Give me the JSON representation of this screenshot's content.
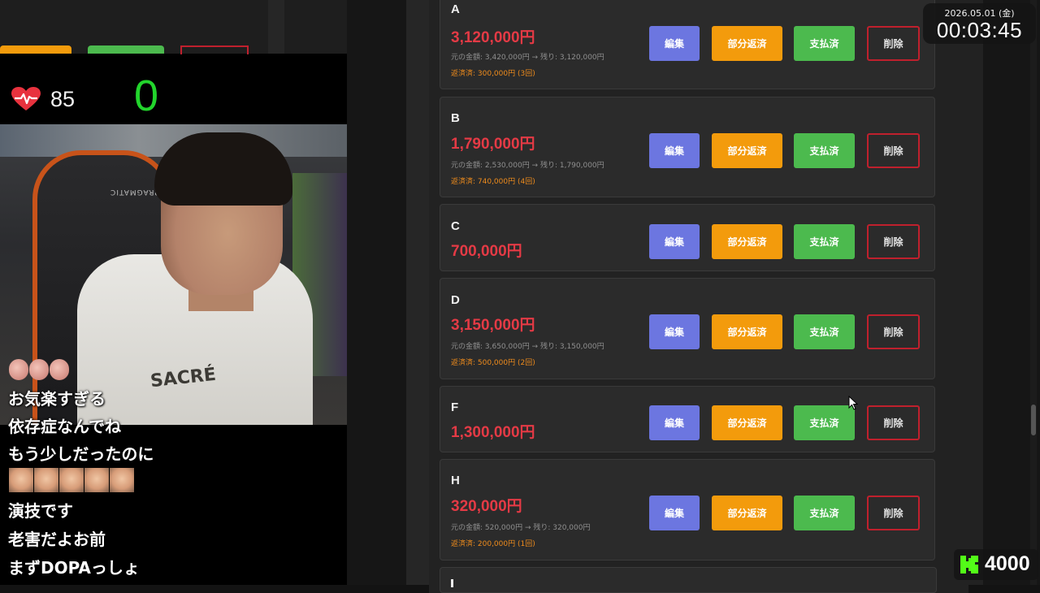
{
  "overlay": {
    "heart_rate": "85",
    "counter": "0",
    "chair_label": "PRAGMATIC",
    "shirt_print": "SACRÉ",
    "chat": [
      "お気楽すぎる",
      "依存症なんでね",
      "もう少しだったのに",
      "演技です",
      "老害だよお前",
      "まずDOPAっしょ"
    ]
  },
  "clock": {
    "date": "2026.05.01 (金)",
    "time": "00:03:45"
  },
  "kick_viewers": "4000",
  "buttons": {
    "edit": "編集",
    "partial": "部分返済",
    "paid": "支払済",
    "delete": "削除"
  },
  "debts": [
    {
      "name": "A",
      "amount": "3,120,000円",
      "detail": "元の金額: 3,420,000円 → 残り: 3,120,000円",
      "repaid": "返済済: 300,000円 (3回)"
    },
    {
      "name": "B",
      "amount": "1,790,000円",
      "detail": "元の金額: 2,530,000円 → 残り: 1,790,000円",
      "repaid": "返済済: 740,000円 (4回)"
    },
    {
      "name": "C",
      "amount": "700,000円",
      "detail": "",
      "repaid": ""
    },
    {
      "name": "D",
      "amount": "3,150,000円",
      "detail": "元の金額: 3,650,000円 → 残り: 3,150,000円",
      "repaid": "返済済: 500,000円 (2回)"
    },
    {
      "name": "F",
      "amount": "1,300,000円",
      "detail": "",
      "repaid": ""
    },
    {
      "name": "H",
      "amount": "320,000円",
      "detail": "元の金額: 520,000円 → 残り: 320,000円",
      "repaid": "返済済: 200,000円 (1回)"
    }
  ],
  "colors": {
    "amount_red": "#e43a45",
    "edit_blue": "#6c76e0",
    "partial_orange": "#f39b0c",
    "paid_green": "#4cba4e",
    "delete_border": "#c0202d",
    "kick_green": "#53fc18"
  }
}
